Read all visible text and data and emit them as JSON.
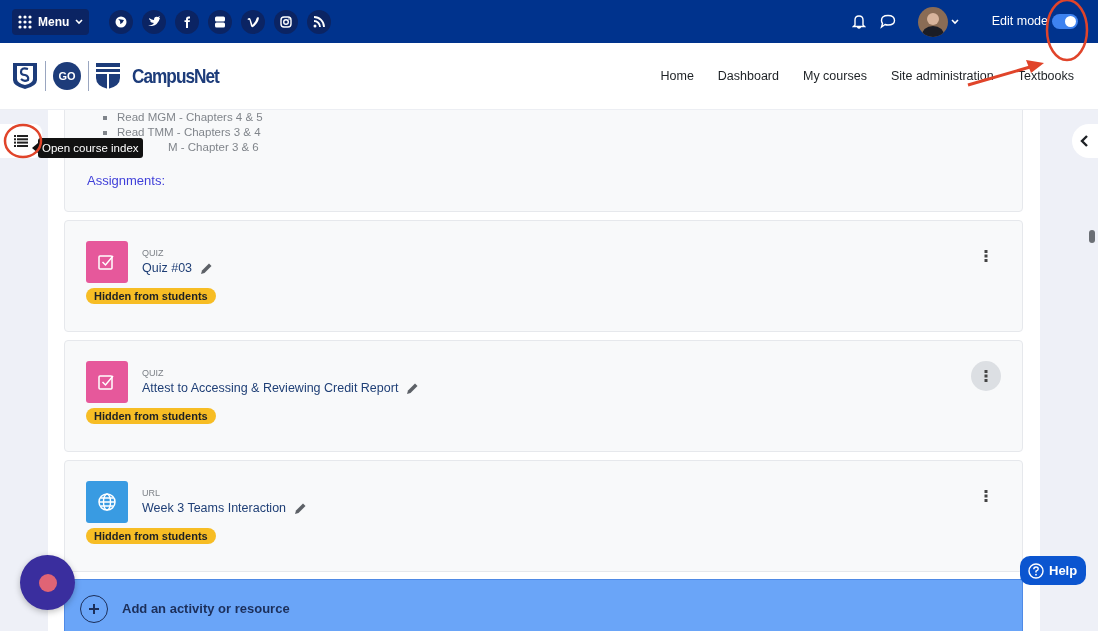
{
  "topbar": {
    "menu_label": "Menu",
    "social_links": [
      {
        "kind": "globe"
      },
      {
        "kind": "twitter"
      },
      {
        "kind": "facebook"
      },
      {
        "kind": "youtube"
      },
      {
        "kind": "vimeo"
      },
      {
        "kind": "instagram"
      },
      {
        "kind": "rss"
      }
    ],
    "edit_mode": {
      "label": "Edit mode",
      "on": true
    }
  },
  "header": {
    "logo_badge": "GO",
    "site_name": "CampusNet",
    "nav_links": [
      "Home",
      "Dashboard",
      "My courses",
      "Site administration",
      "Textbooks"
    ]
  },
  "course_index": {
    "tooltip": "Open course index"
  },
  "section": {
    "readings": [
      {
        "text": "Read MGM - Chapters 4 & 5",
        "covered": false
      },
      {
        "text": "Read TMM - Chapters 3 & 4",
        "covered": false
      },
      {
        "text": "M - Chapter 3 & 6",
        "covered": true
      }
    ],
    "assignments_label": "Assignments:"
  },
  "activities": [
    {
      "kind": "quiz",
      "type_label": "QUIZ",
      "title": "Quiz #03",
      "badge": "Hidden from students",
      "menu_hovered": false
    },
    {
      "kind": "quiz",
      "type_label": "QUIZ",
      "title": "Attest to Accessing & Reviewing Credit Report",
      "badge": "Hidden from students",
      "menu_hovered": true
    },
    {
      "kind": "url",
      "type_label": "URL",
      "title": "Week 3 Teams Interaction",
      "badge": "Hidden from students",
      "menu_hovered": false
    }
  ],
  "add_activity": {
    "label": "Add an activity or resource"
  },
  "help": {
    "label": "Help"
  }
}
